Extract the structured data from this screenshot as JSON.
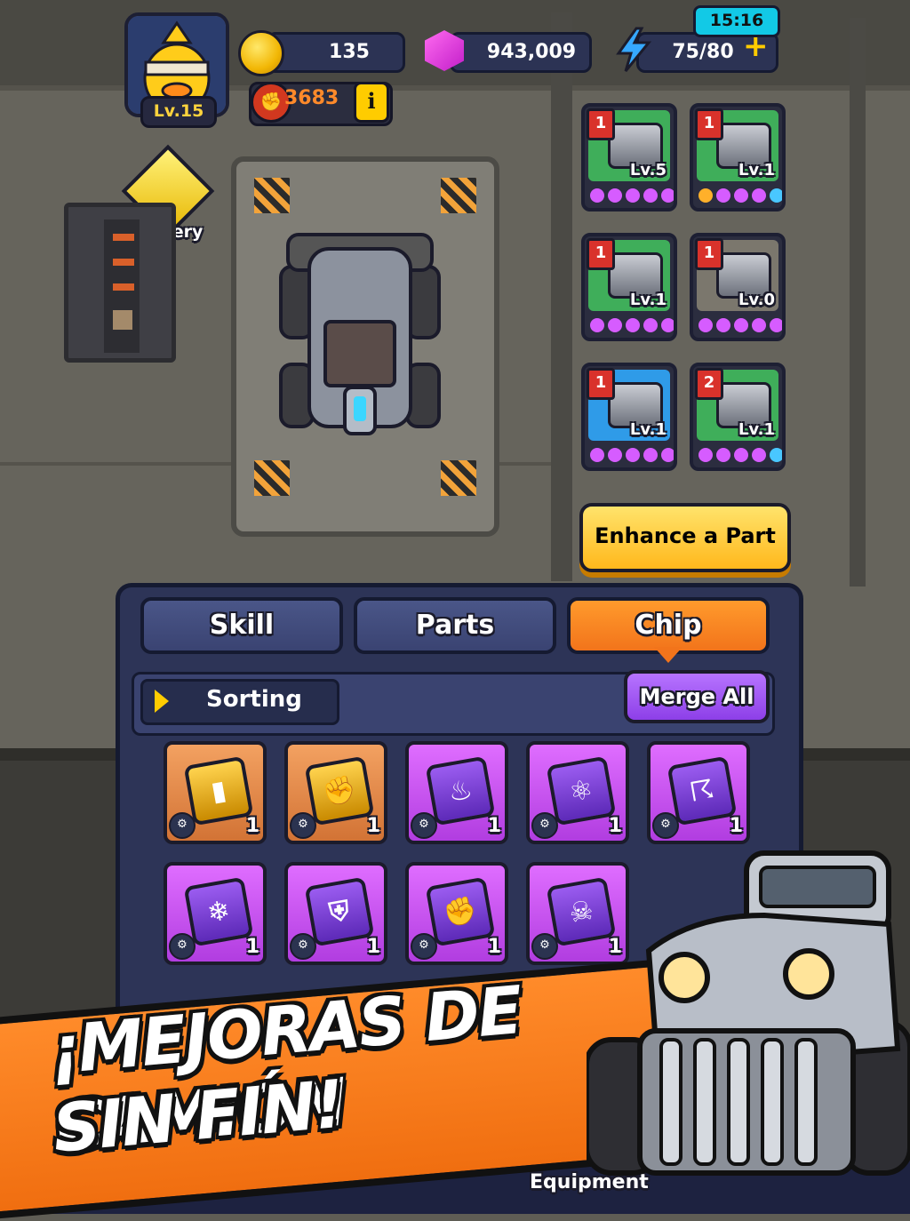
{
  "player": {
    "level": "Lv.15"
  },
  "currencies": {
    "gold": "135",
    "gems": "943,009",
    "energy": "75/80",
    "energy_timer": "15:16"
  },
  "power": {
    "value": "3683"
  },
  "mastery": {
    "label": "Mastery"
  },
  "parts": [
    {
      "count": "1",
      "level": "Lv.5",
      "bg": "#3fae5a",
      "dots": [
        "#d65cff",
        "#d65cff",
        "#d65cff",
        "#d65cff",
        "#d65cff"
      ]
    },
    {
      "count": "1",
      "level": "Lv.1",
      "bg": "#3fae5a",
      "dots": [
        "#ffb02a",
        "#d65cff",
        "#d65cff",
        "#d65cff",
        "#49c7ff"
      ]
    },
    {
      "count": "1",
      "level": "Lv.1",
      "bg": "#3fae5a",
      "dots": [
        "#d65cff",
        "#d65cff",
        "#d65cff",
        "#d65cff",
        "#d65cff"
      ]
    },
    {
      "count": "1",
      "level": "Lv.0",
      "bg": "#7b776d",
      "dots": [
        "#d65cff",
        "#d65cff",
        "#d65cff",
        "#d65cff",
        "#d65cff"
      ]
    },
    {
      "count": "1",
      "level": "Lv.1",
      "bg": "#2f9be8",
      "dots": [
        "#d65cff",
        "#d65cff",
        "#d65cff",
        "#d65cff",
        "#d65cff"
      ]
    },
    {
      "count": "2",
      "level": "Lv.1",
      "bg": "#3fae5a",
      "dots": [
        "#d65cff",
        "#d65cff",
        "#d65cff",
        "#d65cff",
        "#49c7ff"
      ]
    }
  ],
  "enhance_button": "Enhance a Part",
  "tabs": [
    {
      "label": "Skill"
    },
    {
      "label": "Parts"
    },
    {
      "label": "Chip"
    }
  ],
  "sorting_label": "Sorting",
  "merge_all": "Merge All",
  "chips_row1": [
    {
      "rarity": "orange",
      "icon": "bullet-icon",
      "count": "1"
    },
    {
      "rarity": "orange",
      "icon": "fist-icon",
      "count": "1"
    },
    {
      "rarity": "purple",
      "icon": "fire-icon",
      "count": "1"
    },
    {
      "rarity": "purple",
      "icon": "atom-icon",
      "count": "1"
    },
    {
      "rarity": "purple",
      "icon": "tornado-icon",
      "count": "1"
    }
  ],
  "chips_row2": [
    {
      "rarity": "purple",
      "icon": "snowflake-icon",
      "count": "1"
    },
    {
      "rarity": "purple",
      "icon": "shield-icon",
      "count": "1"
    },
    {
      "rarity": "purple",
      "icon": "fist-icon",
      "count": "1"
    },
    {
      "rarity": "purple",
      "icon": "skull-icon",
      "count": "1"
    }
  ],
  "banner": {
    "line1": "¡MEJORAS DE CAMIÓN",
    "line2": "SIN FIN!"
  },
  "nav": {
    "equipment": "Equipment"
  },
  "colors": {
    "accent_orange": "#f2741b",
    "panel_navy": "#2d3457",
    "gold": "#ffcc00"
  }
}
